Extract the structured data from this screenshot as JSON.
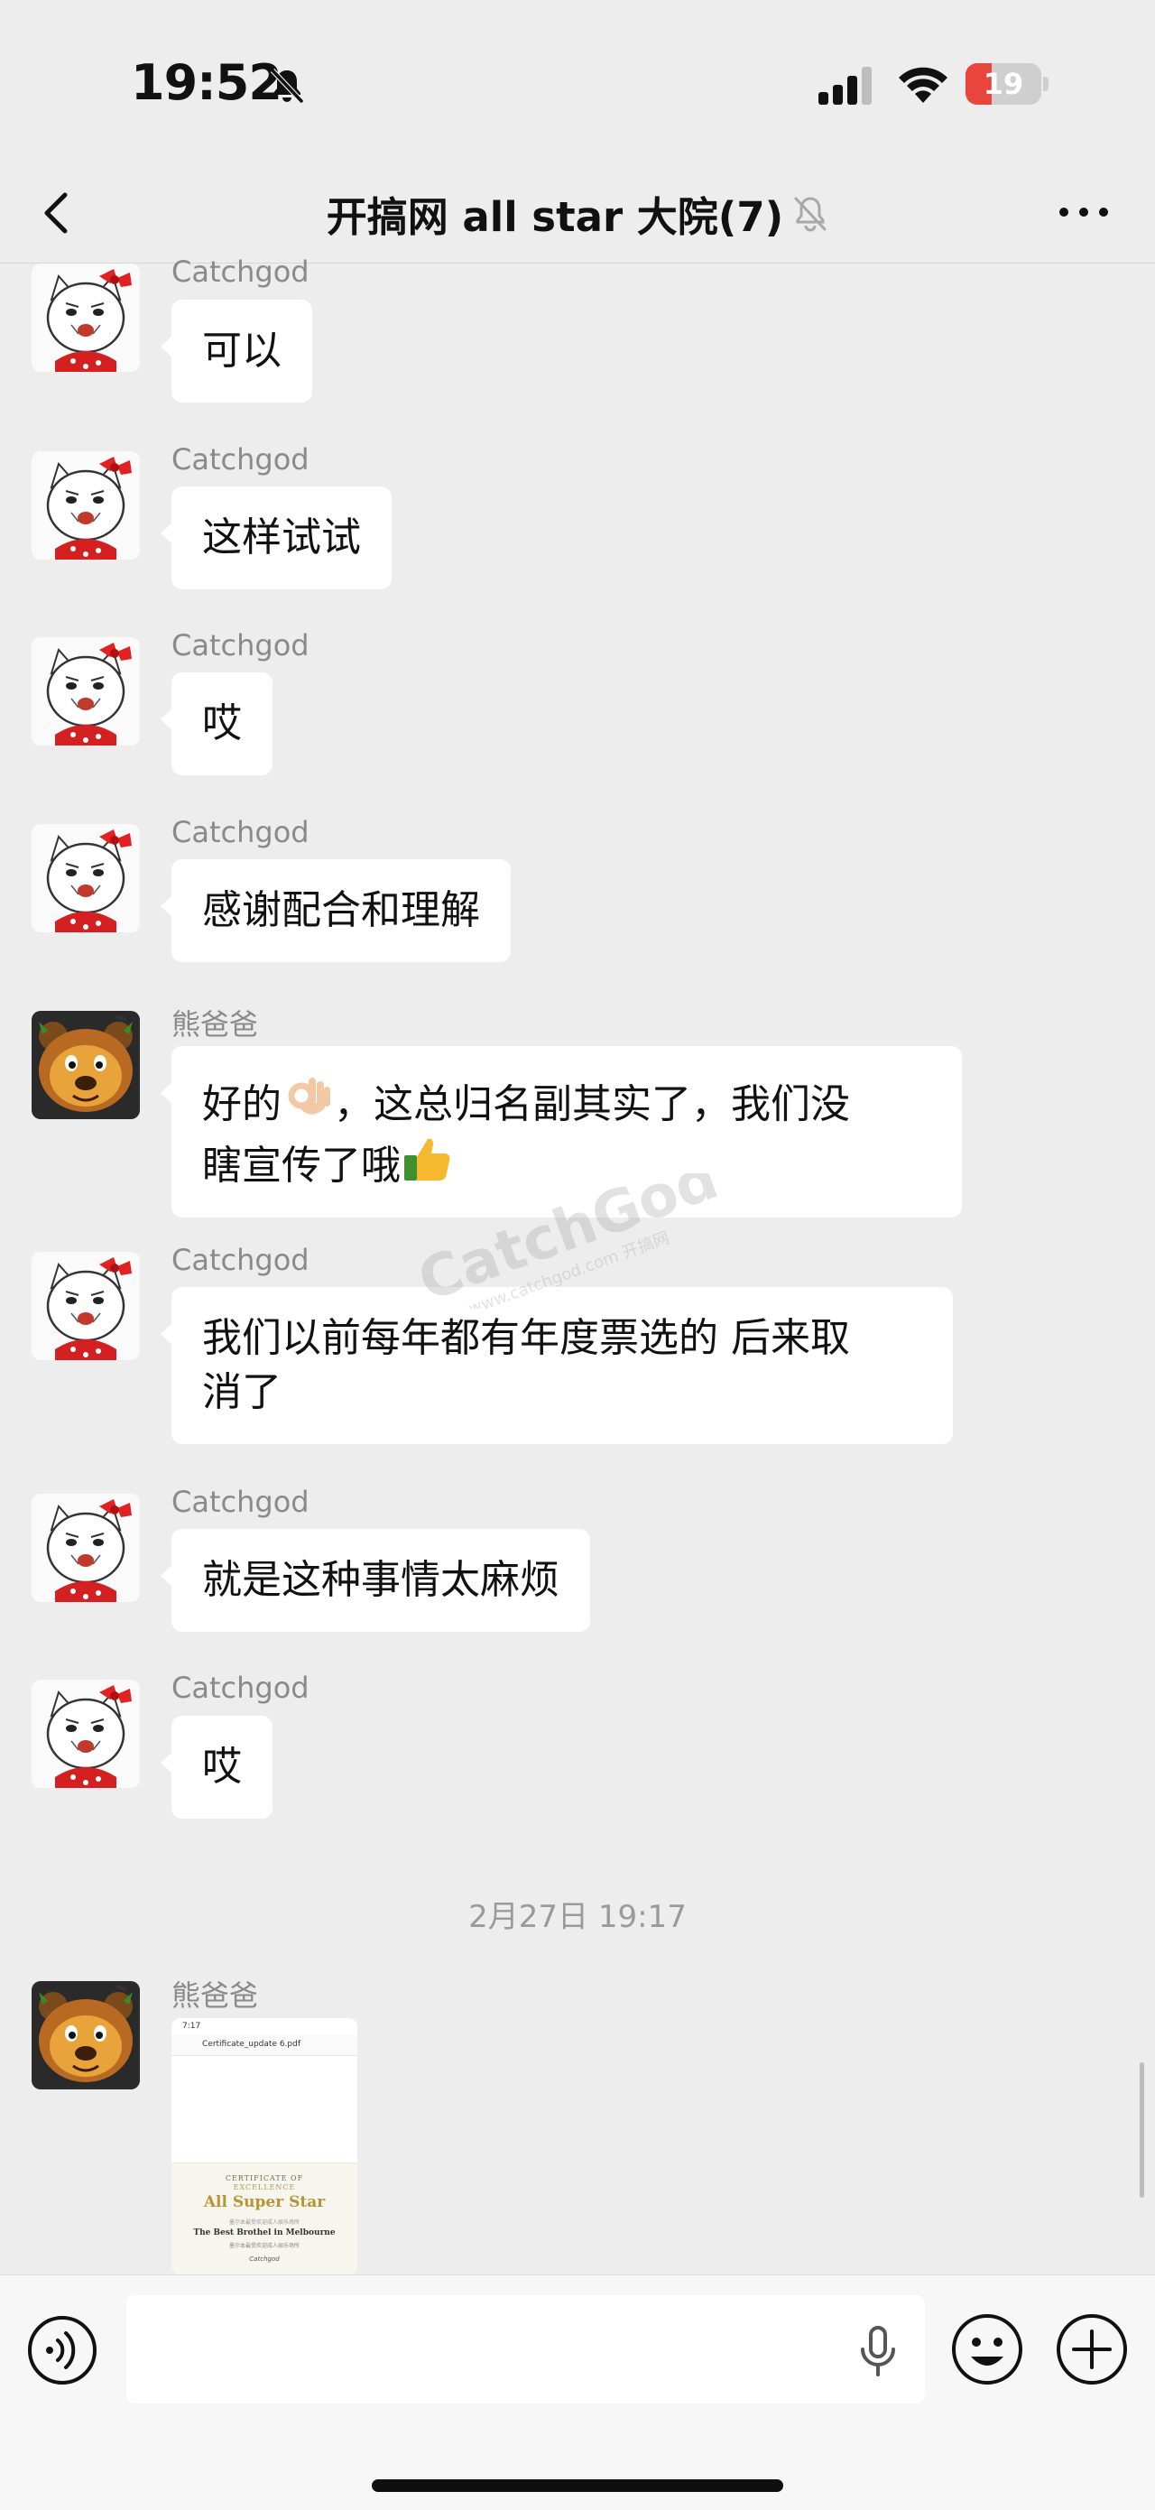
{
  "status_bar": {
    "time": "19:52",
    "battery_level": "19"
  },
  "nav": {
    "title": "开搞网 all star 大院(7)"
  },
  "messages": [
    {
      "sender": "Catchgod",
      "text": "可以"
    },
    {
      "sender": "Catchgod",
      "text": "这样试试"
    },
    {
      "sender": "Catchgod",
      "text": "哎"
    },
    {
      "sender": "Catchgod",
      "text": "感谢配合和理解"
    },
    {
      "sender": "熊爸爸",
      "line1_a": "好的",
      "line1_b": "，这总归名副其实了，我们没",
      "line2": "瞎宣传了哦"
    },
    {
      "sender": "Catchgod",
      "line1": "我们以前每年都有年度票选的 后来取",
      "line2": "消了"
    },
    {
      "sender": "Catchgod",
      "text": "就是这种事情太麻烦"
    },
    {
      "sender": "Catchgod",
      "text": "哎"
    },
    {
      "sender": "熊爸爸",
      "file": {
        "status_time": "7:17",
        "name": "Certificate_update 6.pdf",
        "cert_line1": "CERTIFICATE OF",
        "cert_line2": "EXCELLENCE",
        "cert_title": "All Super Star",
        "cert_sub": "墨尔本最受欢迎成人娱乐场所",
        "cert_heading": "The Best Brothel in Melbourne",
        "cert_sub2": "墨尔本最受欢迎成人娱乐场所",
        "cert_signature": "Catchgod"
      }
    }
  ],
  "time_divider": "2月27日 19:17",
  "watermark": {
    "main": "CatchGod",
    "sub": "www.catchgod.com 开搞网"
  },
  "colors": {
    "background": "#ededed",
    "bubble": "#ffffff",
    "battery_low": "#e8453c"
  }
}
